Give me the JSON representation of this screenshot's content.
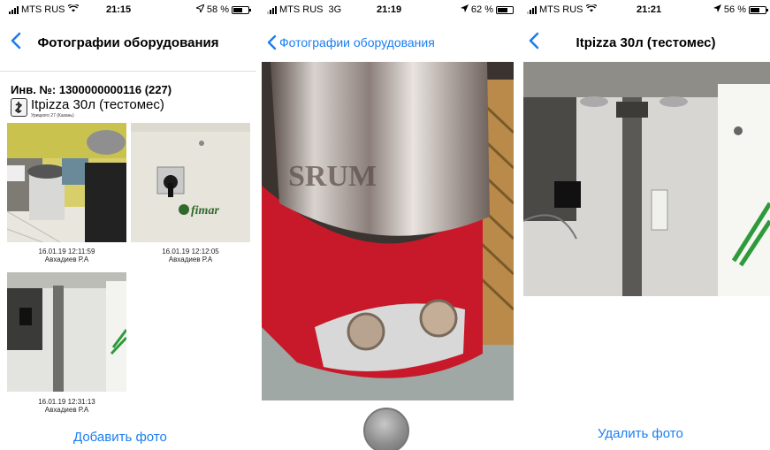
{
  "screens": [
    {
      "status": {
        "carrier": "MTS RUS",
        "network": "",
        "time": "21:15",
        "battery": "58 %",
        "battery_level": 0.58
      },
      "nav": {
        "title": "Фотографии оборудования"
      },
      "inventory": "Инв. №: 1300000000116 (227)",
      "equipment_name": "Itpizza 30л (тестомес)",
      "address": "Урицкого 27 (Казань)",
      "photos": [
        {
          "date": "16.01.19  12:11:59",
          "author": "Авхадиев Р.А"
        },
        {
          "date": "16.01.19  12:12:05",
          "author": "Авхадиев Р.А"
        },
        {
          "date": "16.01.19  12:31:13",
          "author": "Авхадиев Р.А"
        }
      ],
      "action": "Добавить фото"
    },
    {
      "status": {
        "carrier": "MTS RUS",
        "network": "3G",
        "time": "21:19",
        "battery": "62 %",
        "battery_level": 0.62
      },
      "nav": {
        "back": "Фотографии оборудования"
      }
    },
    {
      "status": {
        "carrier": "MTS RUS",
        "network": "",
        "time": "21:21",
        "battery": "56 %",
        "battery_level": 0.56
      },
      "nav": {
        "title": "Itpizza 30л (тестомес)"
      },
      "action": "Удалить фото"
    }
  ],
  "colors": {
    "accent": "#1a7ef2"
  },
  "icons": [
    "signal-icon",
    "wifi-icon",
    "location-arrow-icon",
    "battery-icon",
    "back-chevron-icon",
    "equipment-icon",
    "capture-button"
  ]
}
